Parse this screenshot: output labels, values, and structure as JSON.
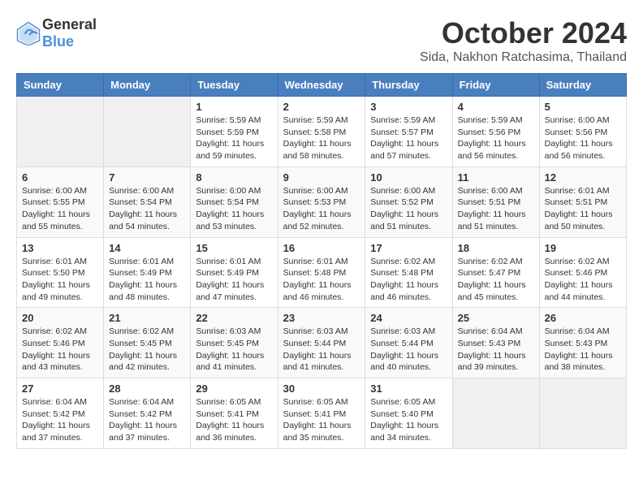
{
  "header": {
    "logo_general": "General",
    "logo_blue": "Blue",
    "month": "October 2024",
    "location": "Sida, Nakhon Ratchasima, Thailand"
  },
  "days_of_week": [
    "Sunday",
    "Monday",
    "Tuesday",
    "Wednesday",
    "Thursday",
    "Friday",
    "Saturday"
  ],
  "weeks": [
    [
      {
        "day": "",
        "info": ""
      },
      {
        "day": "",
        "info": ""
      },
      {
        "day": "1",
        "info": "Sunrise: 5:59 AM\nSunset: 5:59 PM\nDaylight: 11 hours and 59 minutes."
      },
      {
        "day": "2",
        "info": "Sunrise: 5:59 AM\nSunset: 5:58 PM\nDaylight: 11 hours and 58 minutes."
      },
      {
        "day": "3",
        "info": "Sunrise: 5:59 AM\nSunset: 5:57 PM\nDaylight: 11 hours and 57 minutes."
      },
      {
        "day": "4",
        "info": "Sunrise: 5:59 AM\nSunset: 5:56 PM\nDaylight: 11 hours and 56 minutes."
      },
      {
        "day": "5",
        "info": "Sunrise: 6:00 AM\nSunset: 5:56 PM\nDaylight: 11 hours and 56 minutes."
      }
    ],
    [
      {
        "day": "6",
        "info": "Sunrise: 6:00 AM\nSunset: 5:55 PM\nDaylight: 11 hours and 55 minutes."
      },
      {
        "day": "7",
        "info": "Sunrise: 6:00 AM\nSunset: 5:54 PM\nDaylight: 11 hours and 54 minutes."
      },
      {
        "day": "8",
        "info": "Sunrise: 6:00 AM\nSunset: 5:54 PM\nDaylight: 11 hours and 53 minutes."
      },
      {
        "day": "9",
        "info": "Sunrise: 6:00 AM\nSunset: 5:53 PM\nDaylight: 11 hours and 52 minutes."
      },
      {
        "day": "10",
        "info": "Sunrise: 6:00 AM\nSunset: 5:52 PM\nDaylight: 11 hours and 51 minutes."
      },
      {
        "day": "11",
        "info": "Sunrise: 6:00 AM\nSunset: 5:51 PM\nDaylight: 11 hours and 51 minutes."
      },
      {
        "day": "12",
        "info": "Sunrise: 6:01 AM\nSunset: 5:51 PM\nDaylight: 11 hours and 50 minutes."
      }
    ],
    [
      {
        "day": "13",
        "info": "Sunrise: 6:01 AM\nSunset: 5:50 PM\nDaylight: 11 hours and 49 minutes."
      },
      {
        "day": "14",
        "info": "Sunrise: 6:01 AM\nSunset: 5:49 PM\nDaylight: 11 hours and 48 minutes."
      },
      {
        "day": "15",
        "info": "Sunrise: 6:01 AM\nSunset: 5:49 PM\nDaylight: 11 hours and 47 minutes."
      },
      {
        "day": "16",
        "info": "Sunrise: 6:01 AM\nSunset: 5:48 PM\nDaylight: 11 hours and 46 minutes."
      },
      {
        "day": "17",
        "info": "Sunrise: 6:02 AM\nSunset: 5:48 PM\nDaylight: 11 hours and 46 minutes."
      },
      {
        "day": "18",
        "info": "Sunrise: 6:02 AM\nSunset: 5:47 PM\nDaylight: 11 hours and 45 minutes."
      },
      {
        "day": "19",
        "info": "Sunrise: 6:02 AM\nSunset: 5:46 PM\nDaylight: 11 hours and 44 minutes."
      }
    ],
    [
      {
        "day": "20",
        "info": "Sunrise: 6:02 AM\nSunset: 5:46 PM\nDaylight: 11 hours and 43 minutes."
      },
      {
        "day": "21",
        "info": "Sunrise: 6:02 AM\nSunset: 5:45 PM\nDaylight: 11 hours and 42 minutes."
      },
      {
        "day": "22",
        "info": "Sunrise: 6:03 AM\nSunset: 5:45 PM\nDaylight: 11 hours and 41 minutes."
      },
      {
        "day": "23",
        "info": "Sunrise: 6:03 AM\nSunset: 5:44 PM\nDaylight: 11 hours and 41 minutes."
      },
      {
        "day": "24",
        "info": "Sunrise: 6:03 AM\nSunset: 5:44 PM\nDaylight: 11 hours and 40 minutes."
      },
      {
        "day": "25",
        "info": "Sunrise: 6:04 AM\nSunset: 5:43 PM\nDaylight: 11 hours and 39 minutes."
      },
      {
        "day": "26",
        "info": "Sunrise: 6:04 AM\nSunset: 5:43 PM\nDaylight: 11 hours and 38 minutes."
      }
    ],
    [
      {
        "day": "27",
        "info": "Sunrise: 6:04 AM\nSunset: 5:42 PM\nDaylight: 11 hours and 37 minutes."
      },
      {
        "day": "28",
        "info": "Sunrise: 6:04 AM\nSunset: 5:42 PM\nDaylight: 11 hours and 37 minutes."
      },
      {
        "day": "29",
        "info": "Sunrise: 6:05 AM\nSunset: 5:41 PM\nDaylight: 11 hours and 36 minutes."
      },
      {
        "day": "30",
        "info": "Sunrise: 6:05 AM\nSunset: 5:41 PM\nDaylight: 11 hours and 35 minutes."
      },
      {
        "day": "31",
        "info": "Sunrise: 6:05 AM\nSunset: 5:40 PM\nDaylight: 11 hours and 34 minutes."
      },
      {
        "day": "",
        "info": ""
      },
      {
        "day": "",
        "info": ""
      }
    ]
  ]
}
